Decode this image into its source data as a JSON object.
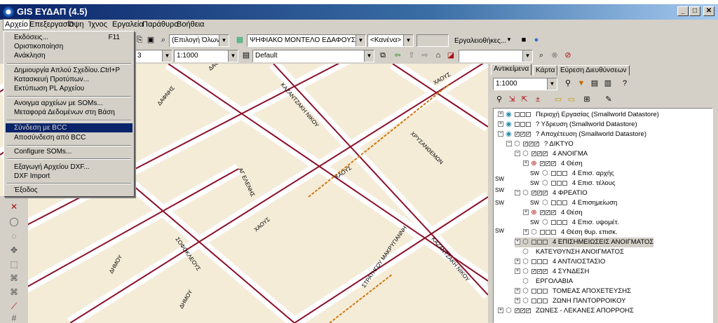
{
  "window": {
    "title": "GIS ΕΥΔΑΠ (4.5)"
  },
  "menu": [
    "Αρχείο",
    "Επεξεργασία",
    "Όψη",
    "Ίχνος",
    "Εργαλεία",
    "Παράθυρο",
    "Βοήθεια"
  ],
  "file_menu": {
    "items": [
      {
        "label": "Εκδόσεις...",
        "shortcut": "F11"
      },
      {
        "label": "Οριστικοποίηση",
        "shortcut": ""
      },
      {
        "label": "Ανάκληση",
        "shortcut": ""
      },
      {
        "label": "Δημιουργία Απλού Σχεδίου...",
        "shortcut": "Ctrl+P"
      },
      {
        "label": "Κατασκευή Προτύπων...",
        "shortcut": ""
      },
      {
        "label": "Εκτύπωση PL Αρχείου",
        "shortcut": ""
      },
      {
        "label": "Ανοιγμα αρχείων με SOMs...",
        "shortcut": ""
      },
      {
        "label": "Μεταφορά Δεδομένων στη Βάση",
        "shortcut": ""
      },
      {
        "label": "Σύνδεση με BCC",
        "shortcut": ""
      },
      {
        "label": "Αποσύνδεση από BCC",
        "shortcut": ""
      },
      {
        "label": "Configure SOMs...",
        "shortcut": ""
      },
      {
        "label": "Εξαγωγή Αρχείου DXF...",
        "shortcut": ""
      },
      {
        "label": "DXF Import",
        "shortcut": ""
      },
      {
        "label": "Έξοδος",
        "shortcut": ""
      }
    ]
  },
  "toolbar": {
    "selection_combo": "(Επιλογή Όλων)",
    "dem_combo": "ΨΗΦΙΑΚΟ ΜΟΝΤΕΛΟ ΕΔΑΦΟΥΣ (NGI)",
    "none_combo": "<Κανένα>",
    "tools_label": "Εργαλειοθήκες...",
    "layer_combo": "3",
    "scale_combo": "1:1000",
    "style_combo": "Default",
    "blank_combo": ""
  },
  "map": {
    "street_labels": [
      "ΔΑΦΝ",
      "ΔΑΦΝΗΣ",
      "ΚΑΖΑΝΤΖΑΚΗ ΝΙΚΟΥ",
      "ΧΑΟΥΣ",
      "ΧΡΥΣΑΝΘΕΜΩΝ",
      "ΑΓ ΕΛΕΝΗΣ",
      "ΧΑΟΥΣ",
      "ΣΟΦΟΚΛΕΟΥΣ",
      "ΧΑΟΥΣ",
      "ΣΤΡΑΤΗΓΟΥ ΜΑΚΡΥΓΙΑΝΝΗ",
      "ΚΑΖΑΝΤΖΑΚΗ ΝΙΚΟΥ",
      "ΔΗΜΟΥ",
      "ΔΗΜΟΥ"
    ]
  },
  "panel": {
    "tabs": [
      "Αντικείμενα",
      "Κάρτα",
      "Εύρεση Διευθύνσεων"
    ],
    "scale": "1:1000",
    "tree": [
      {
        "label": "Περιοχή Εργασίας (Smallworld Datastore)",
        "sw": ""
      },
      {
        "label": "? Υδρευση (Smallworld Datastore)",
        "sw": ""
      },
      {
        "label": "? Αποχέτευση (Smallworld Datastore)",
        "sw": ""
      },
      {
        "label": "? ΔΙΚΤΥΟ",
        "sw": ""
      },
      {
        "label": "4 ΑΝΟΙΓΜΑ",
        "sw": ""
      },
      {
        "label": "4 Θέση",
        "sw": ""
      },
      {
        "label": "4 Επισ. αρχής",
        "sw": "SW"
      },
      {
        "label": "4 Επισ. τέλους",
        "sw": "SW"
      },
      {
        "label": "4 ΦΡΕΑΤΙΟ",
        "sw": ""
      },
      {
        "label": "4 Επισημείωση",
        "sw": "SW"
      },
      {
        "label": "4 Θέση",
        "sw": ""
      },
      {
        "label": "4 Επισ. υψομέτ.",
        "sw": "SW"
      },
      {
        "label": "4 Θέση θυρ. επισκ.",
        "sw": ""
      },
      {
        "label": "4 ΕΠΙΣΗΜΕΙΩΣΕΙΣ ΑΝΟΙΓΜΑΤΟΣ",
        "sw": ""
      },
      {
        "label": "ΚΑΤΕΥΘΥΝΣΗ ΑΝΟΙΓΜΑΤΟΣ",
        "sw": ""
      },
      {
        "label": "4 ΑΝΤΛΙΟΣΤΑΣΙΟ",
        "sw": ""
      },
      {
        "label": "4 ΣΥΝΔΕΣΗ",
        "sw": ""
      },
      {
        "label": "ΕΡΓΟΛΑΒΙΑ",
        "sw": ""
      },
      {
        "label": "ΤΟΜΕΑΣ ΑΠΟΧΕΤΕΥΣΗΣ",
        "sw": ""
      },
      {
        "label": "ΖΩΝΗ ΠΑΝΤΟΡΡΟΙΚΟΥ",
        "sw": ""
      },
      {
        "label": "ΖΩΝΕΣ - ΛΕΚΑΝΕΣ ΑΠΟΡΡΟΗΣ",
        "sw": ""
      }
    ],
    "left_sw": [
      "SW",
      "SW",
      "SW",
      "SW"
    ]
  },
  "colors": {
    "title_start": "#0a246a",
    "menu_highlight": "#0a246a",
    "road_pipe": "#8a1028",
    "sewer_orange": "#d07a10",
    "block_fill": "#f5ecd8"
  }
}
